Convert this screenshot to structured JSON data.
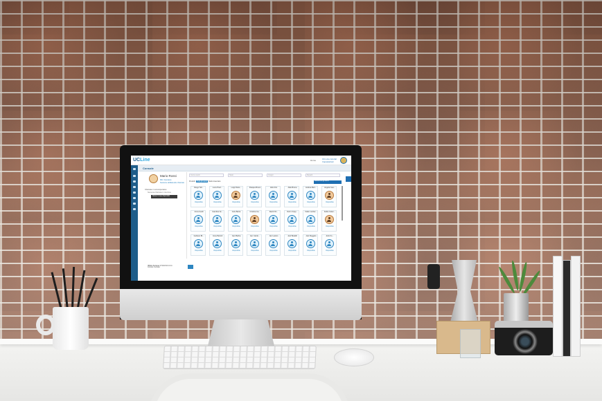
{
  "app": {
    "logo_text": "UC",
    "logo_accent": "Line",
    "header": {
      "home_label": "Home",
      "line1": "UC-Line tutorial",
      "line2": "Impostazioni"
    },
    "page_title": "Console",
    "profile": {
      "name": "Mario Rossi",
      "role": "Mitt. Operatore",
      "status": "Sessione abilitata alle chiamate",
      "section_title": "Chiamate in corso/operatore",
      "section_sub": "Nessuna chiamata in ricezione",
      "action_button": "Attesa / Linee disponibili",
      "footer_label": "Ultimo Accesso",
      "footer_value": "27/02/2019 10:41",
      "footer_sub": "Console Centrale"
    },
    "filters": {
      "search_placeholder": "Cerca utenti",
      "f2": "Stato",
      "f3": "Gruppi",
      "f4": "Reparti"
    },
    "radios": {
      "r1": "Preferiti",
      "r2": "Tutti gli utenti",
      "r3": "Modo Avanzato"
    },
    "blue_tag": "Mostra tutti gli utenti",
    "cards": [
      {
        "name": "Diego Tell...",
        "status": "Disponibile",
        "photo": false
      },
      {
        "name": "Luca Previ...",
        "status": "Disponibile",
        "photo": false
      },
      {
        "name": "Luigi Pelos...",
        "status": "Disponibile",
        "photo": true
      },
      {
        "name": "Pasqua Bruno",
        "status": "Disponibile",
        "photo": false
      },
      {
        "name": "Aldo Fini",
        "status": "Disponibile",
        "photo": false
      },
      {
        "name": "Aldo Bruna",
        "status": "Disponibile",
        "photo": false
      },
      {
        "name": "Andrea Bert...",
        "status": "Disponibile",
        "photo": false
      },
      {
        "name": "Angela Gue...",
        "status": "Disponibile",
        "photo": true
      },
      {
        "name": "Anna Guidi",
        "status": "Disponibile",
        "photo": false
      },
      {
        "name": "Carolina Ve...",
        "status": "Disponibile",
        "photo": false
      },
      {
        "name": "Cole Barra",
        "status": "Disponibile",
        "photo": false
      },
      {
        "name": "Cristina Ca...",
        "status": "Disponibile",
        "photo": true
      },
      {
        "name": "David Vit...",
        "status": "Disponibile",
        "photo": false
      },
      {
        "name": "Dorin Cripp...",
        "status": "Disponibile",
        "photo": false
      },
      {
        "name": "Fabio Lazzar...",
        "status": "Disponibile",
        "photo": false
      },
      {
        "name": "Fabio Celen...",
        "status": "Disponibile",
        "photo": true
      },
      {
        "name": "Guiliano Bi...",
        "status": "Disponibile",
        "photo": false
      },
      {
        "name": "Irene Bertoli",
        "status": "Disponibile",
        "photo": false
      },
      {
        "name": "Ivan Barba",
        "status": "Disponibile",
        "photo": false
      },
      {
        "name": "Jan Cardo...",
        "status": "Disponibile",
        "photo": false
      },
      {
        "name": "Jan Lazaro",
        "status": "Disponibile",
        "photo": false
      },
      {
        "name": "Joel Baraldi",
        "status": "Disponibile",
        "photo": false
      },
      {
        "name": "Joel Ruggelo",
        "status": "Disponibile",
        "photo": false
      },
      {
        "name": "Julio Fo...",
        "status": "Disponibile",
        "photo": false
      }
    ]
  }
}
